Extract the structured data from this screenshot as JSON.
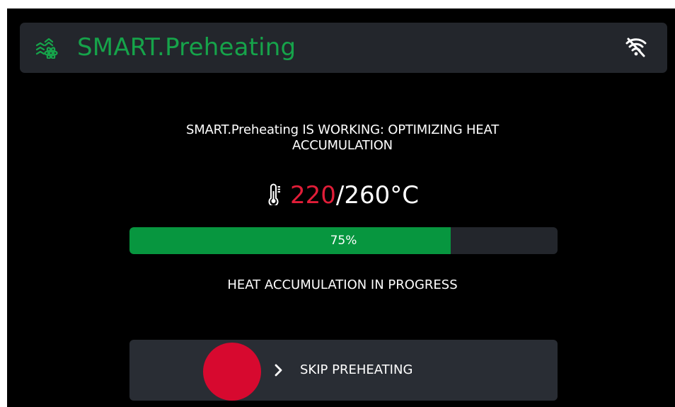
{
  "header": {
    "title": "SMART.Preheating",
    "logo_icon": "smart-preheating-logo-icon",
    "wifi_icon": "wifi-off-icon"
  },
  "message": "SMART.Preheating IS WORKING: OPTIMIZING HEAT ACCUMULATION",
  "temperature": {
    "icon": "thermometer-icon",
    "current": "220",
    "target_display": "/260°C"
  },
  "progress": {
    "value": 75,
    "label": "75%"
  },
  "status": "HEAT ACCUMULATION IN PROGRESS",
  "skip": {
    "label": "SKIP PREHEATING",
    "chevron_icon": "chevron-right-icon"
  },
  "colors": {
    "background": "#000000",
    "panel": "#23262c",
    "brand_green": "#16a34a",
    "progress_green": "#07963f",
    "current_temperature": "#e11d38",
    "skip_knob": "#d7092f",
    "text": "#ffffff"
  }
}
